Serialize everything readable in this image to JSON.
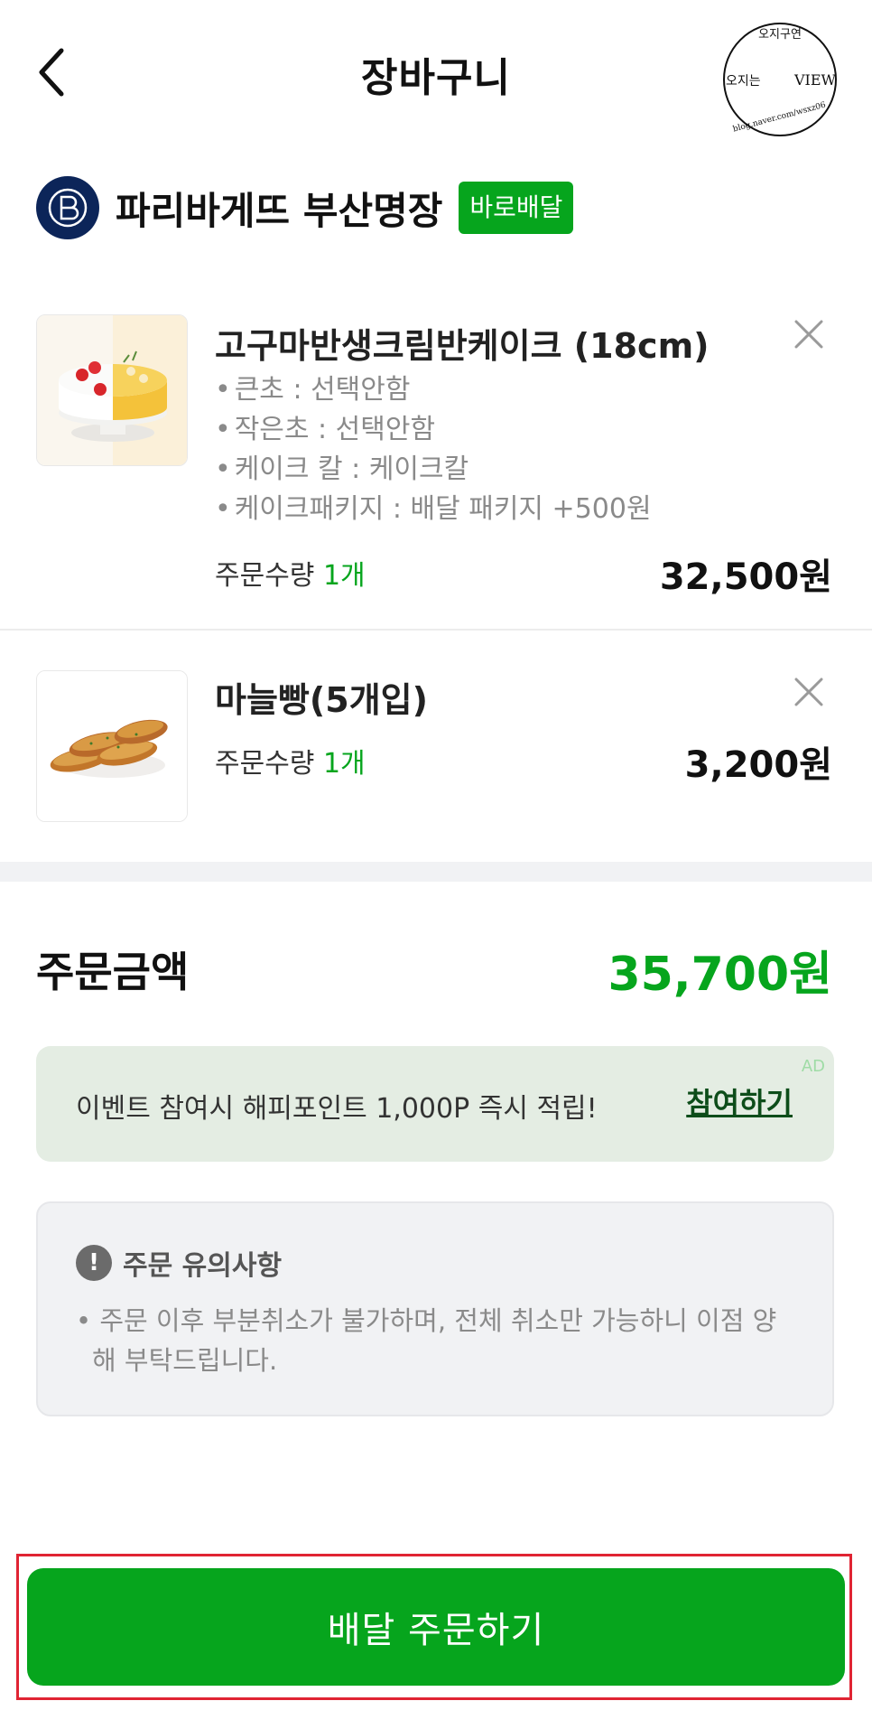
{
  "header": {
    "title": "장바구니",
    "stamp": {
      "top": "오지구연",
      "left": "오지는",
      "right": "VIEW",
      "bottom": "blog.naver.com/wsxz06"
    }
  },
  "store": {
    "name": "파리바게뜨 부산명장",
    "badge": "바로배달",
    "logo_color": "#0c2559"
  },
  "items": [
    {
      "name": "고구마반생크림반케이크 (18cm)",
      "options": [
        "큰초 : 선택안함",
        "작은초 : 선택안함",
        "케이크 칼 : 케이크칼",
        "케이크패키지 : 배달 패키지 +500원"
      ],
      "qty_label": "주문수량",
      "qty_value": "1개",
      "price": "32,500원"
    },
    {
      "name": "마늘빵(5개입)",
      "qty_label": "주문수량",
      "qty_value": "1개",
      "price": "3,200원"
    }
  ],
  "total": {
    "label": "주문금액",
    "value": "35,700원"
  },
  "ad": {
    "text": "이벤트 참여시 해피포인트 1,000P 즉시 적립!",
    "link": "참여하기",
    "tag": "AD"
  },
  "notice": {
    "title": "주문 유의사항",
    "body": "주문 이후 부분취소가 불가하며, 전체 취소만 가능하니 이점 양해 부탁드립니다."
  },
  "cta": {
    "label": "배달 주문하기"
  },
  "colors": {
    "accent": "#06a51d",
    "highlight_frame": "#e02433"
  }
}
